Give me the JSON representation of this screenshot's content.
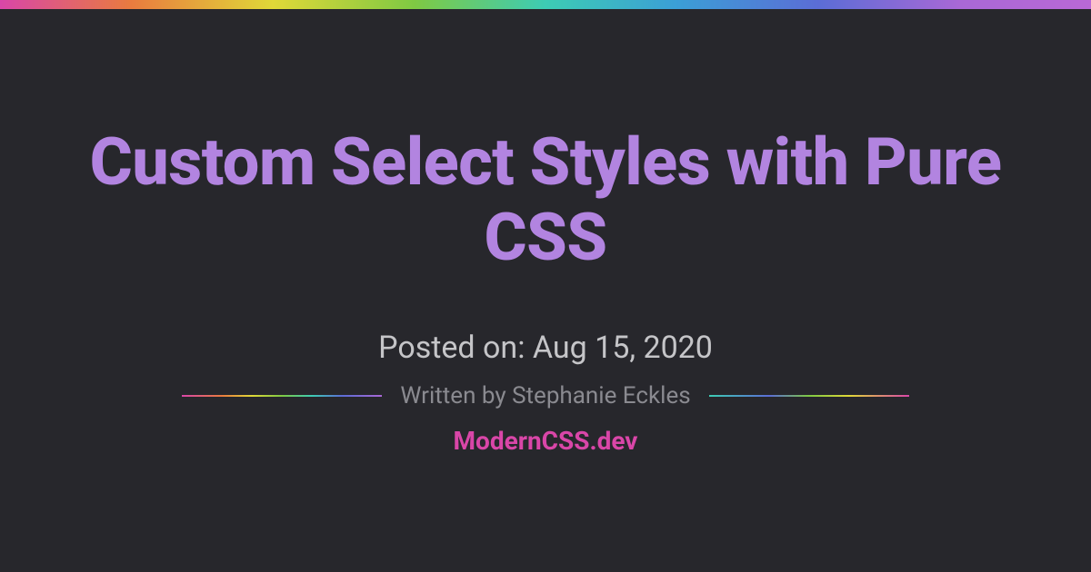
{
  "title": "Custom Select Styles with Pure CSS",
  "posted": "Posted on: Aug 15, 2020",
  "author": "Written by Stephanie Eckles",
  "site": "ModernCSS.dev"
}
